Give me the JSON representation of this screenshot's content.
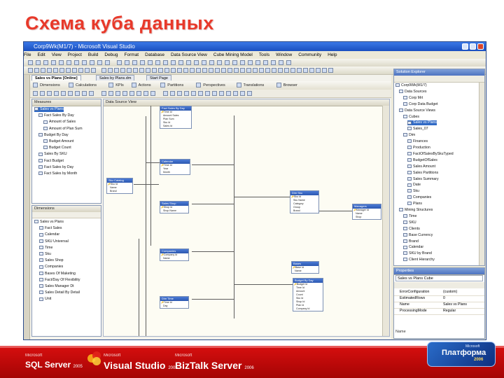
{
  "slide": {
    "title": "Схема куба данных"
  },
  "window": {
    "title": "Corp9Wk(M1/7) - Microsoft Visual Studio",
    "menu": [
      "File",
      "Edit",
      "View",
      "Project",
      "Build",
      "Debug",
      "Format",
      "Database",
      "Data Source View",
      "Cube Mining Model",
      "Tools",
      "Window",
      "Community",
      "Help"
    ]
  },
  "doc_tabs": [
    "Sales vs Plans [Online]",
    "Sales by Plans.dm",
    "Start Page"
  ],
  "dsv_toolbar": [
    "Dimensions",
    "Calculations",
    "KPIs",
    "Actions",
    "Partitions",
    "Perspectives",
    "Translations",
    "Browser"
  ],
  "measures_panel": {
    "header": "Measures",
    "items": [
      "Sales vs Plans",
      "Fact Sales By Day",
      "Amount of Sales",
      "Amount of Plan Sum",
      "Budget By Day",
      "Budget Amount",
      "Budget Count",
      "Sales By SKU",
      "Fact Budget",
      "Fact Sales by Day",
      "Fact Sales by Month"
    ]
  },
  "dimensions_panel": {
    "header": "Dimensions",
    "items": [
      "Sales vs Plans",
      "Fact Sales",
      "Calendar",
      "SKU Universal",
      "Time",
      "Sku",
      "Sales Shop",
      "Companies",
      "Bases Of Maketing",
      "Fact/Day Of Flexibility",
      "Sales Manager Dt",
      "Sales Detail By Detail",
      "Unit"
    ]
  },
  "dsv_header": "Data Source View",
  "tables": [
    {
      "name": "Fact Sales By Day",
      "rows": [
        "Time Id",
        "Amount Sales",
        "Plan Sum",
        "Sku Id",
        "Sales Id"
      ]
    },
    {
      "name": "Calendar",
      "rows": [
        "Time Id",
        "Year",
        "Month"
      ]
    },
    {
      "name": "Sku Catalog",
      "rows": [
        "Sku Id",
        "Name",
        "Brand"
      ]
    },
    {
      "name": "Sales Shop",
      "rows": [
        "Shop Id",
        "Shop Name"
      ]
    },
    {
      "name": "Companies",
      "rows": [
        "Company Id",
        "Name"
      ]
    },
    {
      "name": "Dim Time",
      "rows": [
        "Time Id",
        "Day"
      ]
    },
    {
      "name": "Dim Sku",
      "rows": [
        "Sku Id",
        "Sku Name",
        "Category",
        "Group",
        "Brand"
      ]
    },
    {
      "name": "Budget By Day",
      "rows": [
        "Budget Id",
        "Time Id",
        "Amount",
        "Count",
        "Sku Id",
        "Shop Id",
        "Plan Id",
        "Company Id"
      ]
    },
    {
      "name": "Managers",
      "rows": [
        "Manager Id",
        "Name",
        "Shop"
      ]
    },
    {
      "name": "Bases",
      "rows": [
        "Base Id",
        "Name"
      ]
    },
    {
      "name": "Region",
      "rows": [
        "Region Id",
        "Name",
        "Country"
      ]
    },
    {
      "name": "Sales Detail",
      "rows": [
        "Detail Id",
        "Sales Id",
        "Qty",
        "Price",
        "Sum"
      ]
    }
  ],
  "solution_explorer": {
    "header": "Solution Explorer",
    "items": [
      "Corp9Wk(M1/7)",
      "Data Sources",
      "Corp Mrt",
      "Corp Data Budget",
      "Data Source Views",
      "Cubes",
      "Sales vs Plans",
      "Sales_07",
      "Dim",
      "Finances",
      "Production",
      "FactOfSalesBySkuTyped",
      "BudgetOfSales",
      "Sales Amount",
      "Sales Partitions",
      "Sales Summary",
      "Date",
      "Sku",
      "Companies",
      "Plans",
      "Mining Structures",
      "Time",
      "SKU",
      "Clients",
      "Base Currency",
      "Brand",
      "Calendar",
      "SKU by Brand",
      "Client Hierarchy"
    ]
  },
  "properties": {
    "header": "Properties",
    "object": "Sales vs Plans  Cube",
    "rows": [
      [
        "ErrorConfiguration",
        "(custom)"
      ],
      [
        "EstimatedRows",
        "0"
      ],
      [
        "Name",
        "Sales vs Plans"
      ],
      [
        "ProcessingMode",
        "Regular"
      ]
    ],
    "footer": "Name"
  },
  "footer_brands": [
    {
      "small": "Microsoft",
      "big": "SQL Server",
      "year": "2005"
    },
    {
      "small": "Microsoft",
      "big": "Visual Studio",
      "year": "2005"
    },
    {
      "small": "Microsoft",
      "big": "BizTalk Server",
      "year": "2006"
    }
  ],
  "platform": {
    "small": "Microsoft",
    "name": "Платформа",
    "year": "2006"
  }
}
